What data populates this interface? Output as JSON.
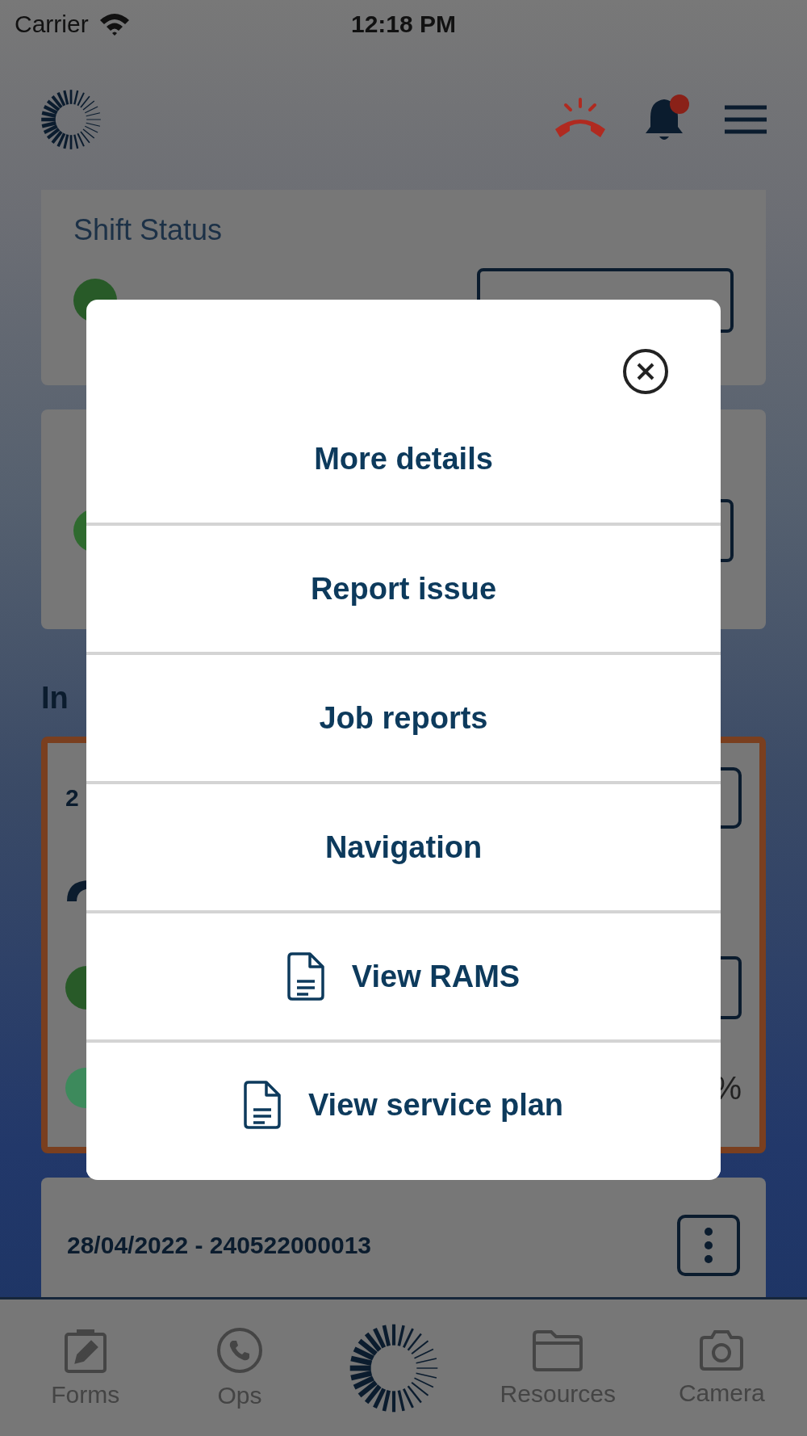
{
  "status_bar": {
    "carrier": "Carrier",
    "time": "12:18 PM"
  },
  "header": {
    "has_notifications": true
  },
  "shift_card": {
    "title": "Shift Status"
  },
  "section_heading": "In",
  "job_cards": [
    {
      "date": "2",
      "highlighted": true,
      "progress": "%"
    },
    {
      "date": "28/04/2022 - 240522000013",
      "highlighted": false
    }
  ],
  "menu": {
    "items": [
      {
        "label": "More details",
        "kind": "text"
      },
      {
        "label": "Report issue",
        "kind": "text"
      },
      {
        "label": "Job reports",
        "kind": "text"
      },
      {
        "label": "Navigation",
        "kind": "text"
      },
      {
        "label": "View RAMS",
        "kind": "document"
      },
      {
        "label": "View service plan",
        "kind": "document"
      }
    ]
  },
  "tab_bar": {
    "items": [
      {
        "label": "Forms",
        "kind": "forms"
      },
      {
        "label": "Ops",
        "kind": "phone"
      },
      {
        "kind": "logo"
      },
      {
        "label": "Resources",
        "kind": "folder"
      },
      {
        "label": "Camera",
        "kind": "camera"
      }
    ]
  }
}
